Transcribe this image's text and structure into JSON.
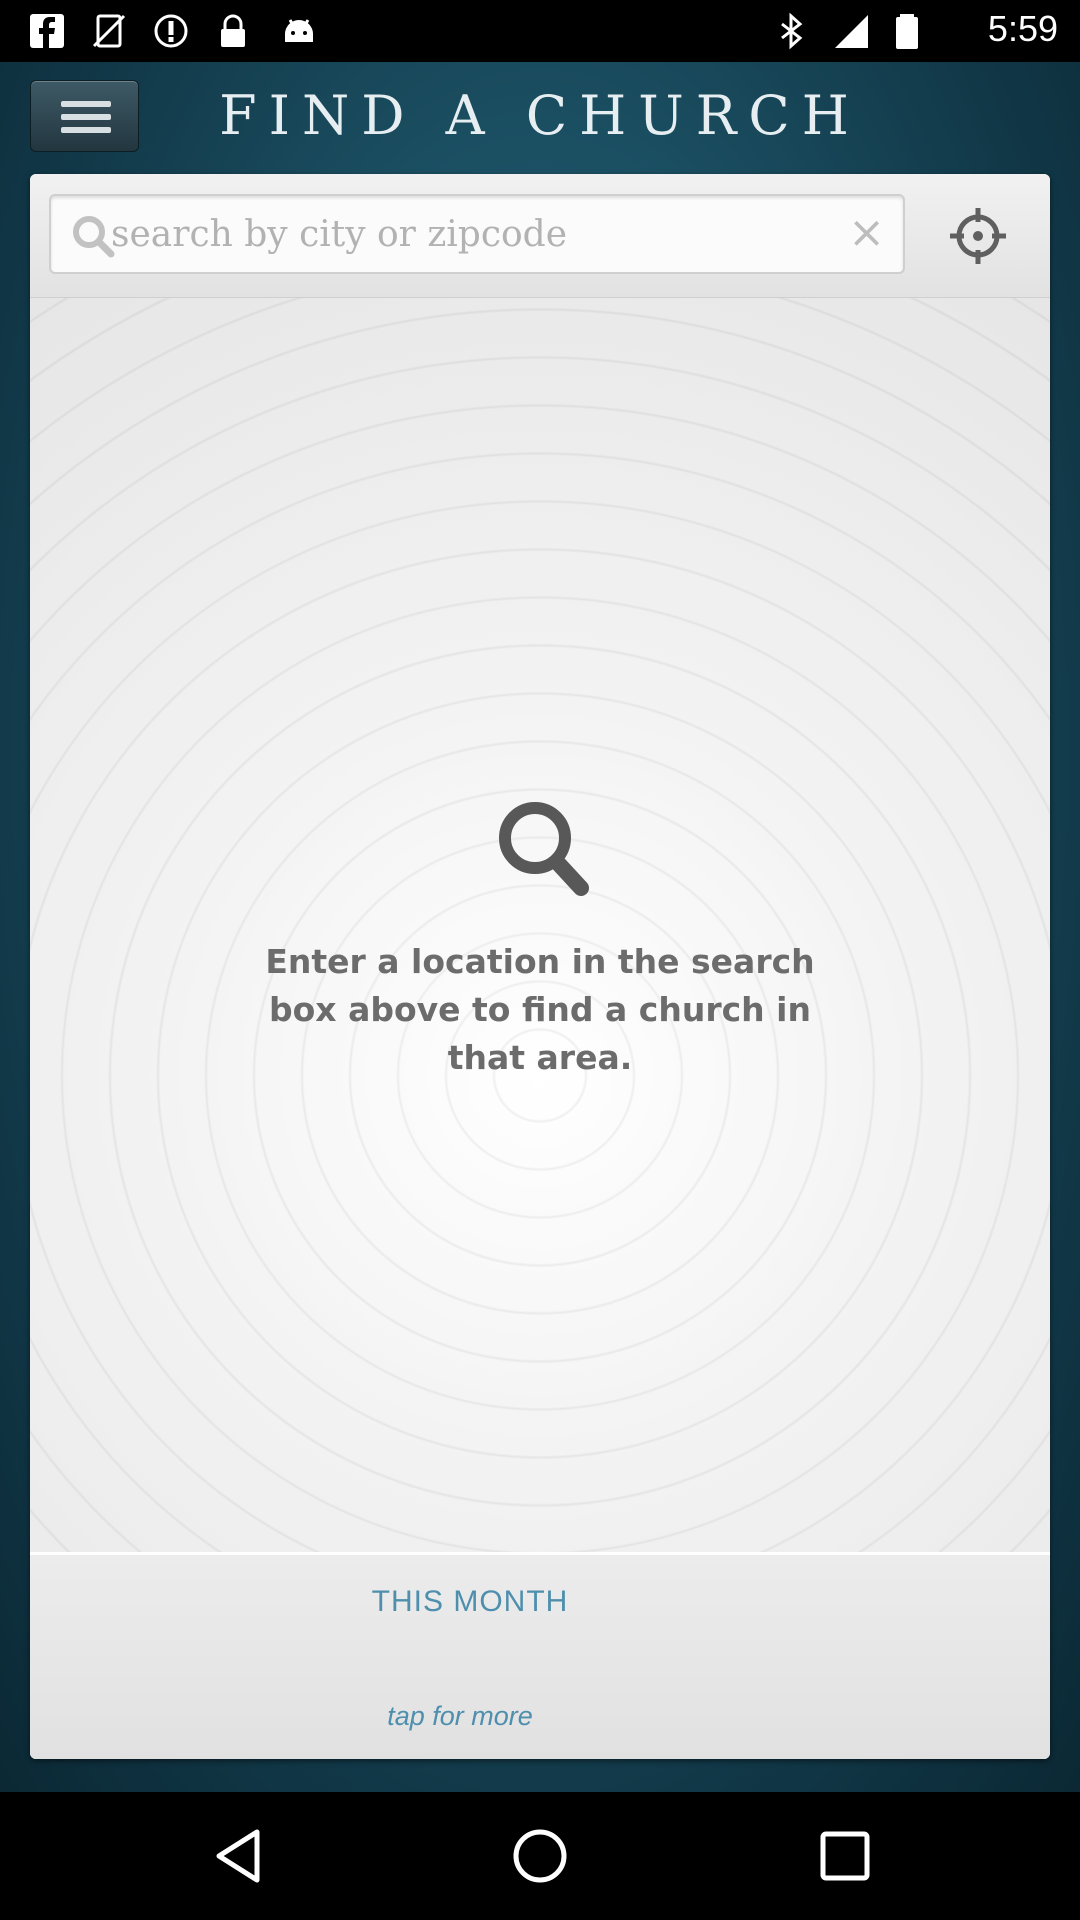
{
  "status_bar": {
    "time": "5:59",
    "left_icons": [
      "facebook-icon",
      "no-sim-icon",
      "alert-icon",
      "lock-icon",
      "android-icon"
    ],
    "right_icons": [
      "bluetooth-icon",
      "signal-icon",
      "battery-icon"
    ]
  },
  "header": {
    "title": "FIND A CHURCH",
    "menu_icon": "menu-icon"
  },
  "search": {
    "placeholder": "search by city or zipcode",
    "value": "",
    "clear_glyph": "×",
    "locate_icon": "crosshair-icon"
  },
  "empty_state": {
    "icon": "search-icon",
    "message": "Enter a location in the search box above to find a church in that area."
  },
  "this_month": {
    "heading": "THIS MONTH",
    "link": "tap for more"
  },
  "nav": {
    "buttons": [
      "back-icon",
      "home-icon",
      "recents-icon"
    ]
  },
  "colors": {
    "accent_text": "#4e8fae",
    "header_bg": "#1d5468"
  }
}
